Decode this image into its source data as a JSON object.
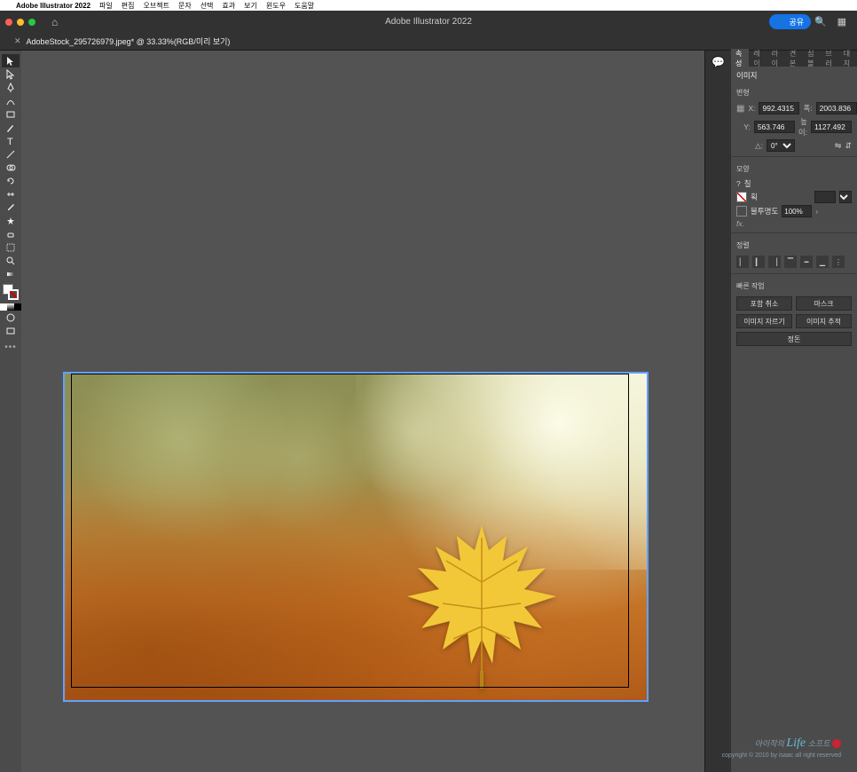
{
  "menubar": {
    "app": "Adobe Illustrator 2022",
    "items": [
      "파일",
      "편집",
      "오브젝트",
      "문자",
      "선택",
      "효과",
      "보기",
      "윈도우",
      "도움말"
    ]
  },
  "window": {
    "title": "Adobe Illustrator 2022",
    "share": "공유"
  },
  "document": {
    "tab_label": "AdobeStock_295726979.jpeg* @ 33.33%(RGB/미리 보기)"
  },
  "panel": {
    "tabs": [
      "속성",
      "레이",
      "라이",
      "견본",
      "심볼",
      "브러",
      "대지"
    ],
    "active_tab": 0,
    "selection_type": "이미지",
    "transform_label": "변형",
    "x_label": "X:",
    "y_label": "Y:",
    "w_label": "폭:",
    "h_label": "높이:",
    "rot_label": "△:",
    "x": "992.4315",
    "y": "563.746",
    "w": "2003.836",
    "h": "1127.492",
    "rotation": "0°",
    "appearance_label": "모양",
    "fill_label": "칠",
    "stroke_label": "획",
    "opacity_label": "불투명도",
    "opacity": "100%",
    "fx_label": "fx.",
    "align_label": "정렬",
    "quick_label": "빠른 작업",
    "btn_embed": "포함 취소",
    "btn_mask": "마스크",
    "btn_crop": "이미지 자르기",
    "btn_trace": "이미지 추적",
    "btn_arrange": "정돈"
  },
  "watermark": {
    "line1_a": "아이작의 ",
    "line1_b": "Life",
    "line1_c": " 소프트",
    "line2": "copyright © 2010 by isaac all right reserved"
  }
}
